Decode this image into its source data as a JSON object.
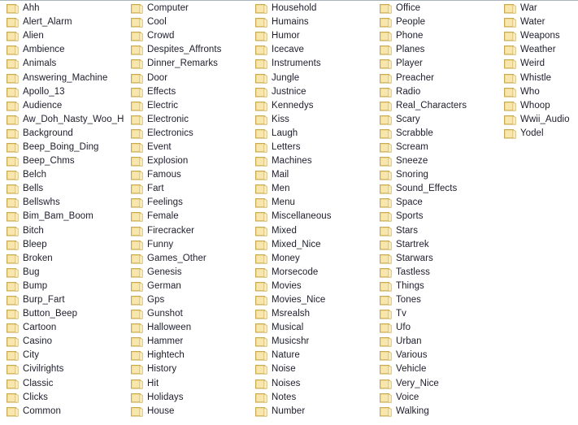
{
  "window": {
    "view_mode": "list",
    "background_color": "#ffffff",
    "top_border_color": "#a8b5bd",
    "text_color": "#1d1d2b",
    "folder_icon_color": "#f2d98c",
    "folder_icon_name": "folder-icon"
  },
  "columns": [
    {
      "index": 1,
      "items": [
        "Ahh",
        "Alert_Alarm",
        "Alien",
        "Ambience",
        "Animals",
        "Answering_Machine",
        "Apollo_13",
        "Audience",
        "Aw_Doh_Nasty_Woo_Hoo",
        "Background",
        "Beep_Boing_Ding",
        "Beep_Chms",
        "Belch",
        "Bells",
        "Bellswhs",
        "Bim_Bam_Boom",
        "Bitch",
        "Bleep",
        "Broken",
        "Bug",
        "Bump",
        "Burp_Fart",
        "Button_Beep",
        "Cartoon",
        "Casino",
        "City",
        "Civilrights",
        "Classic",
        "Clicks",
        "Common"
      ]
    },
    {
      "index": 2,
      "items": [
        "Computer",
        "Cool",
        "Crowd",
        "Despites_Affronts",
        "Dinner_Remarks",
        "Door",
        "Effects",
        "Electric",
        "Electronic",
        "Electronics",
        "Event",
        "Explosion",
        "Famous",
        "Fart",
        "Feelings",
        "Female",
        "Firecracker",
        "Funny",
        "Games_Other",
        "Genesis",
        "German",
        "Gps",
        "Gunshot",
        "Halloween",
        "Hammer",
        "Hightech",
        "History",
        "Hit",
        "Holidays",
        "House"
      ]
    },
    {
      "index": 3,
      "items": [
        "Household",
        "Humains",
        "Humor",
        "Icecave",
        "Instruments",
        "Jungle",
        "Justnice",
        "Kennedys",
        "Kiss",
        "Laugh",
        "Letters",
        "Machines",
        "Mail",
        "Men",
        "Menu",
        "Miscellaneous",
        "Mixed",
        "Mixed_Nice",
        "Money",
        "Morsecode",
        "Movies",
        "Movies_Nice",
        "Msrealsh",
        "Musical",
        "Musicshr",
        "Nature",
        "Noise",
        "Noises",
        "Notes",
        "Number"
      ]
    },
    {
      "index": 4,
      "items": [
        "Office",
        "People",
        "Phone",
        "Planes",
        "Player",
        "Preacher",
        "Radio",
        "Real_Characters",
        "Scary",
        "Scrabble",
        "Scream",
        "Sneeze",
        "Snoring",
        "Sound_Effects",
        "Space",
        "Sports",
        "Stars",
        "Startrek",
        "Starwars",
        "Tastless",
        "Things",
        "Tones",
        "Tv",
        "Ufo",
        "Urban",
        "Various",
        "Vehicle",
        "Very_Nice",
        "Voice",
        "Walking"
      ]
    },
    {
      "index": 5,
      "items": [
        "War",
        "Water",
        "Weapons",
        "Weather",
        "Weird",
        "Whistle",
        "Who",
        "Whoop",
        "Wwii_Audio",
        "Yodel"
      ]
    }
  ]
}
